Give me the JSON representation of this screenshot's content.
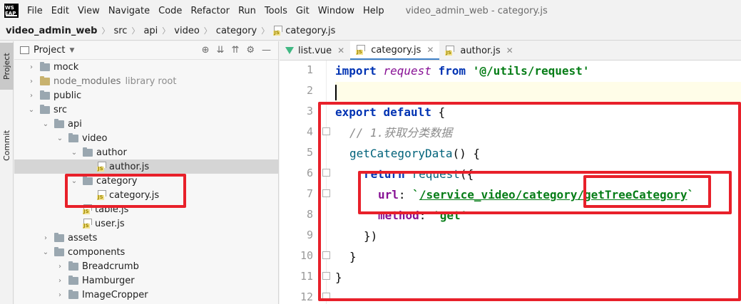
{
  "menubar": {
    "logo_line1": "WS",
    "logo_line2": "EAP",
    "items": [
      "File",
      "Edit",
      "View",
      "Navigate",
      "Code",
      "Refactor",
      "Run",
      "Tools",
      "Git",
      "Window",
      "Help"
    ],
    "window_title": "video_admin_web - category.js"
  },
  "breadcrumb": {
    "items": [
      "video_admin_web",
      "src",
      "api",
      "video",
      "category",
      "category.js"
    ]
  },
  "toolstrip": {
    "project": "Project",
    "commit": "Commit"
  },
  "project_panel": {
    "title": "Project",
    "tree": [
      {
        "label": "mock",
        "type": "folder",
        "depth": 1,
        "expanded": false
      },
      {
        "label": "node_modules",
        "type": "libfolder",
        "depth": 1,
        "expanded": false,
        "note": "library root"
      },
      {
        "label": "public",
        "type": "folder",
        "depth": 1,
        "expanded": false
      },
      {
        "label": "src",
        "type": "folder",
        "depth": 1,
        "expanded": true
      },
      {
        "label": "api",
        "type": "folder",
        "depth": 2,
        "expanded": true
      },
      {
        "label": "video",
        "type": "folder",
        "depth": 3,
        "expanded": true
      },
      {
        "label": "author",
        "type": "folder",
        "depth": 4,
        "expanded": true
      },
      {
        "label": "author.js",
        "type": "js",
        "depth": 5,
        "selected": true
      },
      {
        "label": "category",
        "type": "folder",
        "depth": 4,
        "expanded": true
      },
      {
        "label": "category.js",
        "type": "js",
        "depth": 5
      },
      {
        "label": "table.js",
        "type": "js",
        "depth": 4
      },
      {
        "label": "user.js",
        "type": "js",
        "depth": 4
      },
      {
        "label": "assets",
        "type": "folder",
        "depth": 2,
        "expanded": false
      },
      {
        "label": "components",
        "type": "folder",
        "depth": 2,
        "expanded": true
      },
      {
        "label": "Breadcrumb",
        "type": "folder",
        "depth": 3,
        "expanded": false
      },
      {
        "label": "Hamburger",
        "type": "folder",
        "depth": 3,
        "expanded": false
      },
      {
        "label": "ImageCropper",
        "type": "folder",
        "depth": 3,
        "expanded": false
      }
    ]
  },
  "editor": {
    "tabs": [
      {
        "label": "list.vue",
        "icon": "vue-icon",
        "active": false
      },
      {
        "label": "category.js",
        "icon": "js-icon",
        "active": true
      },
      {
        "label": "author.js",
        "icon": "js-icon",
        "active": false
      }
    ],
    "line_numbers": [
      "1",
      "2",
      "3",
      "4",
      "5",
      "6",
      "7",
      "8",
      "9",
      "10",
      "11",
      "12"
    ],
    "code": {
      "l1_kw1": "import",
      "l1_id": "request",
      "l1_kw2": "from",
      "l1_str": "'@/utils/request'",
      "l3_kw1": "export",
      "l3_kw2": "default",
      "l3_punct": "{",
      "l4_cmt": "// 1.获取分类数据",
      "l5_fn": "getCategoryData",
      "l5_rest": "() {",
      "l6_kw": "return",
      "l6_fn": "request",
      "l6_rest": "({",
      "l7_prop": "url",
      "l7_colon": ": ",
      "l7_q1": "`",
      "l7_path": "/service_video/category/getTreeCategory",
      "l7_q2": "`",
      "l8_prop": "method",
      "l8_colon": ": ",
      "l8_str": "'get'",
      "l9": "})",
      "l10": "}",
      "l11": "}"
    }
  }
}
